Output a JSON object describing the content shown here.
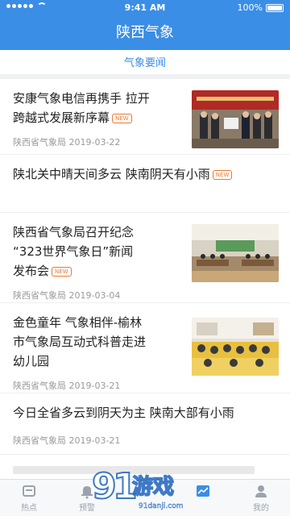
{
  "status_bar": {
    "time": "9:41 AM",
    "battery": "100%"
  },
  "header": {
    "title": "陕西气象"
  },
  "section_tab": {
    "label": "气象要闻"
  },
  "news": [
    {
      "title_lines": [
        "安康气象电信再携手 拉开",
        "跨越式发展新序幕"
      ],
      "badge": "NEW",
      "source": "陕西省气象局",
      "date": "2019-03-22",
      "has_image": true
    },
    {
      "title_lines": [
        "陕北关中晴天间多云 陕南阴天有小雨"
      ],
      "badge": "NEW",
      "source": "",
      "date": "",
      "has_image": false
    },
    {
      "title_lines": [
        "陕西省气象局召开纪念",
        "“323世界气象日”新闻",
        "发布会"
      ],
      "badge": "NEW",
      "source": "陕西省气象局",
      "date": "2019-03-04",
      "has_image": true
    },
    {
      "title_lines": [
        "金色童年 气象相伴-榆林",
        "市气象局互动式科普走进",
        "幼儿园"
      ],
      "badge": "",
      "source": "陕西省气象局",
      "date": "2019-03-21",
      "has_image": true
    },
    {
      "title_lines": [
        "今日全省多云到阴天为主 陕南大部有小雨"
      ],
      "badge": "",
      "source": "陕西省气象局",
      "date": "2019-03-21",
      "has_image": false
    }
  ],
  "tabbar": [
    {
      "label": "热点",
      "icon": "home-icon"
    },
    {
      "label": "预警",
      "icon": "bell-icon"
    },
    {
      "label": "",
      "icon": "center-icon"
    },
    {
      "label": "",
      "icon": "chart-icon"
    },
    {
      "label": "我的",
      "icon": "user-icon"
    }
  ],
  "watermark": {
    "brand": "91游戏",
    "url": "91danji.com"
  },
  "colors": {
    "primary": "#3a8ee6",
    "badge": "#e8792f",
    "meta": "#9a9a9a"
  }
}
